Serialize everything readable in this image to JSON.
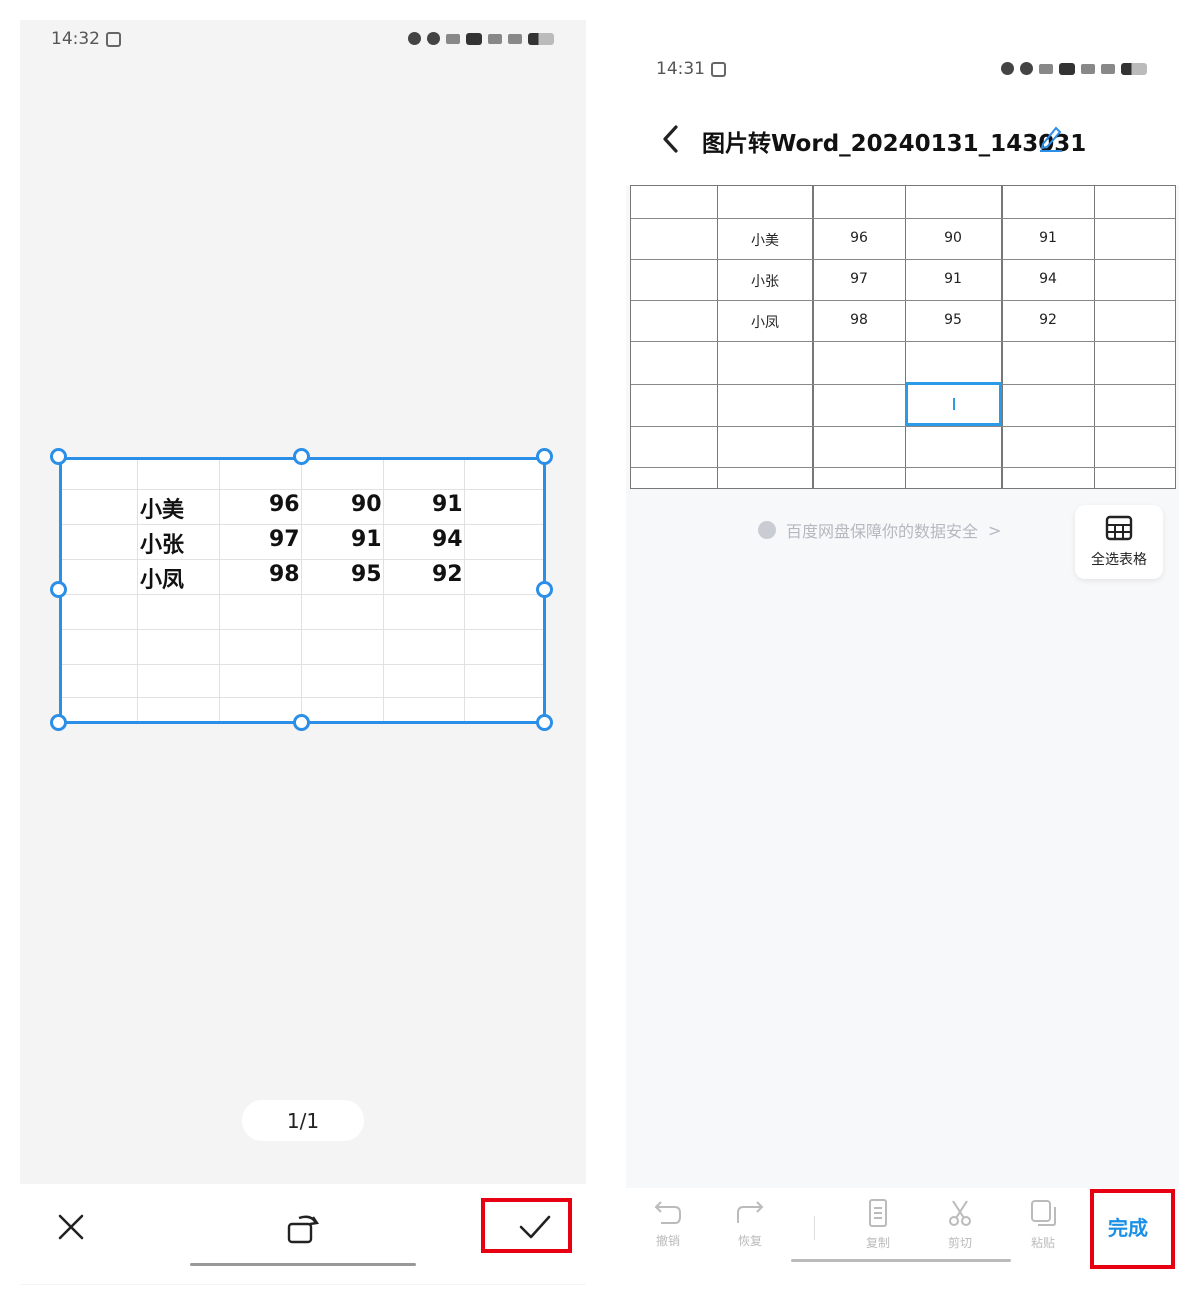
{
  "left": {
    "status_time": "14:32",
    "image_rows": [
      [
        "小美",
        "96",
        "90",
        "91"
      ],
      [
        "小张",
        "97",
        "91",
        "94"
      ],
      [
        "小凤",
        "98",
        "95",
        "92"
      ]
    ],
    "page_indicator": "1/1"
  },
  "right": {
    "status_time": "14:31",
    "doc_title": "图片转Word_20240131_143031",
    "table_rows": [
      [
        "小美",
        "96",
        "90",
        "91"
      ],
      [
        "小张",
        "97",
        "91",
        "94"
      ],
      [
        "小凤",
        "98",
        "95",
        "92"
      ]
    ],
    "security_text": "百度网盘保障你的数据安全",
    "security_arrow": ">",
    "select_table_label": "全选表格",
    "toolbar": {
      "undo": "撤销",
      "redo": "恢复",
      "copy": "复制",
      "cut": "剪切",
      "paste": "粘贴",
      "done": "完成"
    }
  },
  "colors": {
    "accent": "#2b8fe8",
    "done": "#1a8fe5",
    "highlight": "#e60012"
  }
}
